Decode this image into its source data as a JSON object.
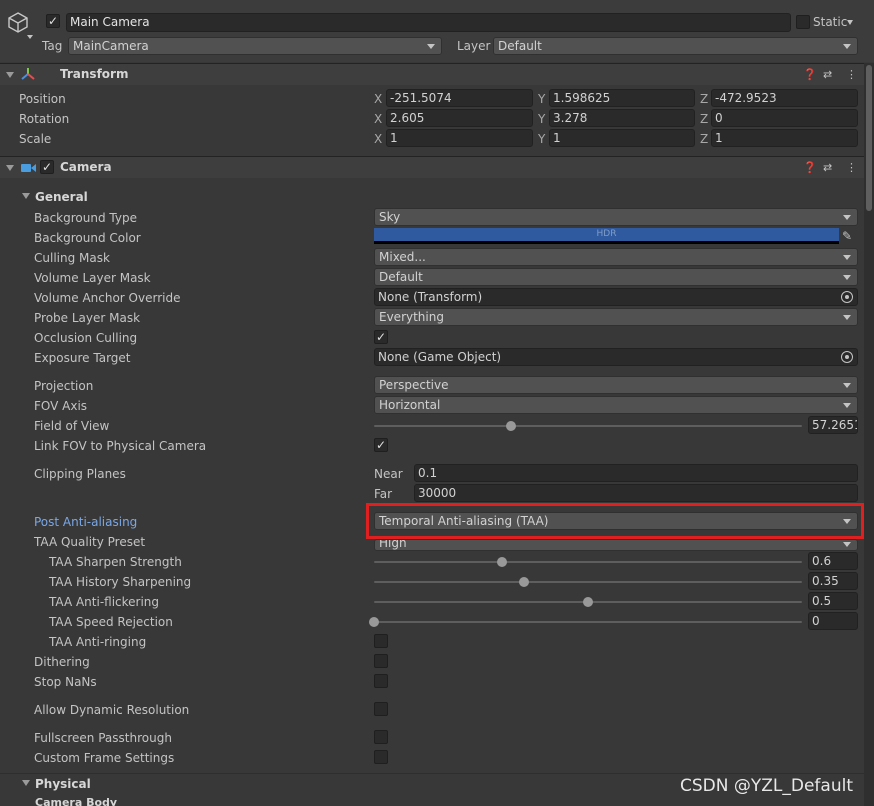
{
  "object": {
    "name": "Main Camera",
    "static_label": "Static",
    "tag_label": "Tag",
    "tag_value": "MainCamera",
    "layer_label": "Layer",
    "layer_value": "Default"
  },
  "transform": {
    "title": "Transform",
    "rows": [
      {
        "label": "Position",
        "x": "-251.5074",
        "y": "1.598625",
        "z": "-472.9523"
      },
      {
        "label": "Rotation",
        "x": "2.605",
        "y": "3.278",
        "z": "0"
      },
      {
        "label": "Scale",
        "x": "1",
        "y": "1",
        "z": "1"
      }
    ],
    "axis": {
      "x": "X",
      "y": "Y",
      "z": "Z"
    }
  },
  "camera": {
    "title": "Camera",
    "general_label": "General",
    "background_type": {
      "label": "Background Type",
      "value": "Sky"
    },
    "background_color": {
      "label": "Background Color",
      "hdr": "HDR",
      "color": "#2f5aa0"
    },
    "culling_mask": {
      "label": "Culling Mask",
      "value": "Mixed..."
    },
    "volume_layer_mask": {
      "label": "Volume Layer Mask",
      "value": "Default"
    },
    "volume_anchor_override": {
      "label": "Volume Anchor Override",
      "value": "None (Transform)"
    },
    "probe_layer_mask": {
      "label": "Probe Layer Mask",
      "value": "Everything"
    },
    "occlusion_culling": {
      "label": "Occlusion Culling",
      "checked": true
    },
    "exposure_target": {
      "label": "Exposure Target",
      "value": "None (Game Object)"
    },
    "projection": {
      "label": "Projection",
      "value": "Perspective"
    },
    "fov_axis": {
      "label": "FOV Axis",
      "value": "Horizontal"
    },
    "field_of_view": {
      "label": "Field of View",
      "value": "57.2651",
      "fraction": 0.32
    },
    "link_fov": {
      "label": "Link FOV to Physical Camera",
      "checked": true
    },
    "clipping_planes": {
      "label": "Clipping Planes",
      "near_label": "Near",
      "near": "0.1",
      "far_label": "Far",
      "far": "30000"
    },
    "post_aa": {
      "label": "Post Anti-aliasing",
      "value": "Temporal Anti-aliasing (TAA)"
    },
    "taa_quality": {
      "label": "TAA Quality Preset",
      "value": "High"
    },
    "taa_sharpen": {
      "label": "TAA Sharpen Strength",
      "value": "0.6",
      "fraction": 0.3
    },
    "taa_history": {
      "label": "TAA History Sharpening",
      "value": "0.35",
      "fraction": 0.35
    },
    "taa_flicker": {
      "label": "TAA Anti-flickering",
      "value": "0.5",
      "fraction": 0.5
    },
    "taa_speed": {
      "label": "TAA Speed Rejection",
      "value": "0",
      "fraction": 0.0
    },
    "taa_ringing": {
      "label": "TAA Anti-ringing",
      "checked": false
    },
    "dithering": {
      "label": "Dithering",
      "checked": false
    },
    "stop_nans": {
      "label": "Stop NaNs",
      "checked": false
    },
    "dynamic_res": {
      "label": "Allow Dynamic Resolution",
      "checked": false
    },
    "fullscreen": {
      "label": "Fullscreen Passthrough",
      "checked": false
    },
    "custom_frame": {
      "label": "Custom Frame Settings",
      "checked": false
    },
    "physical_label": "Physical",
    "camera_body_label": "Camera Body"
  },
  "watermark": "CSDN @YZL_Default",
  "colors": {
    "highlight": "#e02020",
    "accent_label": "#7aa7e6"
  }
}
